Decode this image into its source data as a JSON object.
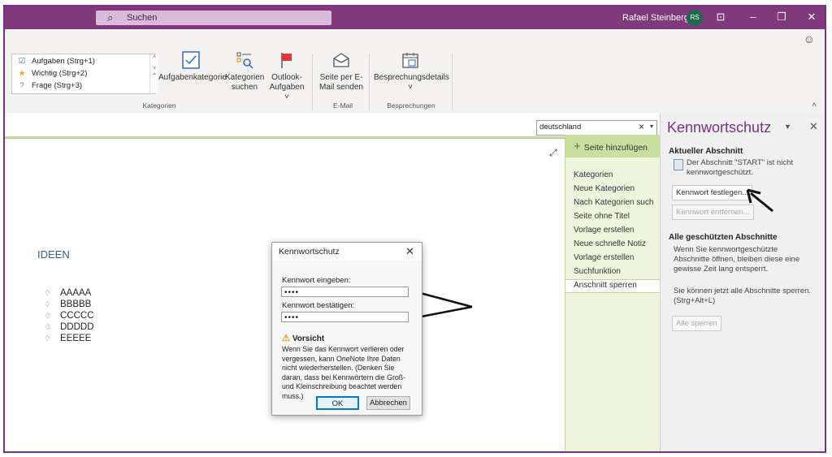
{
  "titlebar": {
    "search_placeholder": "Suchen",
    "user_name": "Rafael Steinberg",
    "user_initials": "RS"
  },
  "ribbon": {
    "tags": [
      {
        "icon": "checkbox-icon",
        "label": "Aufgaben (Strg+1)"
      },
      {
        "icon": "star-icon",
        "label": "Wichtig (Strg+2)"
      },
      {
        "icon": "question-icon",
        "label": "Frage (Strg+3)"
      }
    ],
    "buttons": {
      "aufgabenkategorie": "Aufgabenkategorie",
      "kategorien_suchen_1": "Kategorien",
      "kategorien_suchen_2": "suchen",
      "outlook_1": "Outlook-",
      "outlook_2": "Aufgaben ˅",
      "email_1": "Seite per E-",
      "email_2": "Mail senden",
      "besprechung": "Besprechungsdetails",
      "besprechung_arrow": "˅"
    },
    "groups": {
      "kategorien": "Kategorien",
      "email": "E-Mail",
      "besprechungen": "Besprechungen"
    }
  },
  "page": {
    "find_value": "deutschland",
    "title": "IDEEN",
    "items": [
      "AAAAA",
      "BBBBB",
      "CCCCC",
      "DDDDD",
      "EEEEE"
    ]
  },
  "pagelist": {
    "add_page": "Seite hinzufügen",
    "pages": [
      "Kategorien",
      "Neue Kategorien",
      "Nach Kategorien such",
      "Seite ohne Titel",
      "Vorlage erstellen",
      "Neue schnelle Notiz",
      "Vorlage erstellen",
      "Suchfunktion",
      "Anschnitt sperren"
    ]
  },
  "pane": {
    "title": "Kennwortschutz",
    "current_heading": "Aktueller Abschnitt",
    "current_text_1": "Der Abschnitt \"START\" ist nicht",
    "current_text_2": "kennwortgeschützt.",
    "set_password": "Kennwort festlegen...",
    "remove_password": "Kennwort entfernen...",
    "all_heading": "Alle geschützten Abschnitte",
    "all_text_1": "Wenn Sie kennwortgeschützte",
    "all_text_2": "Abschnitte öffnen, bleiben diese eine",
    "all_text_3": "gewisse Zeit lang entsperrt.",
    "lock_text_1": "Sie können jetzt alle Abschnitte sperren.",
    "lock_text_2": "(Strg+Alt+L)",
    "lock_all": "Alle sperren"
  },
  "dialog": {
    "title": "Kennwortschutz",
    "enter_label": "Kennwort eingeben:",
    "enter_value": "••••",
    "confirm_label": "Kennwort bestätigen:",
    "confirm_value": "••••",
    "warning_title": "Vorsicht",
    "warning_text": "Wenn Sie das Kennwort verlieren oder vergessen, kann OneNote Ihre Daten nicht wiederherstellen. (Denken Sie daran, dass bei Kennwörtern die Groß- und Kleinschreibung beachtet werden muss.)",
    "ok": "OK",
    "cancel": "Abbrechen"
  },
  "colors": {
    "brand": "#80397b",
    "section_green": "#c3d79a",
    "pane_title": "#7a2f86"
  }
}
